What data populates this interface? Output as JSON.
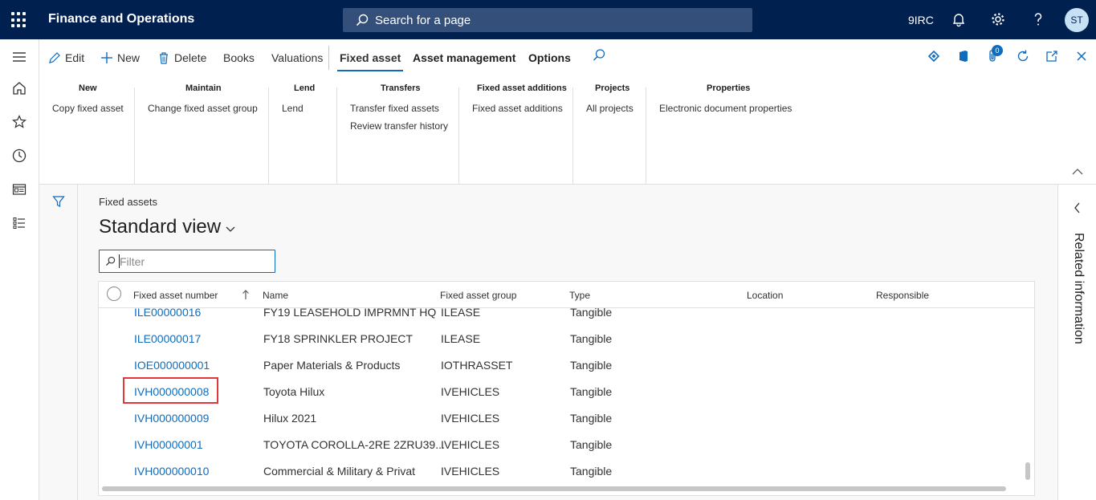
{
  "topbar": {
    "app_title": "Finance and Operations",
    "search_placeholder": "Search for a page",
    "company": "9IRC",
    "avatar_initials": "ST"
  },
  "actionpane": {
    "buttons": {
      "edit": "Edit",
      "new": "New",
      "delete": "Delete",
      "books": "Books",
      "valuations": "Valuations"
    },
    "tabs": {
      "fixed_asset": "Fixed asset",
      "asset_management": "Asset management",
      "options": "Options"
    },
    "attachment_count": "0",
    "groups": [
      {
        "title": "New",
        "items": [
          "Copy fixed asset"
        ]
      },
      {
        "title": "Maintain",
        "items": [
          "Change fixed asset group"
        ]
      },
      {
        "title": "Lend",
        "items": [
          "Lend"
        ]
      },
      {
        "title": "Transfers",
        "items": [
          "Transfer fixed assets",
          "Review transfer history"
        ]
      },
      {
        "title": "Fixed asset additions",
        "items": [
          "Fixed asset additions"
        ]
      },
      {
        "title": "Projects",
        "items": [
          "All projects"
        ]
      },
      {
        "title": "Properties",
        "items": [
          "Electronic document properties"
        ]
      }
    ]
  },
  "content": {
    "breadcrumb": "Fixed assets",
    "view_title": "Standard view",
    "filter_placeholder": "Filter"
  },
  "grid": {
    "columns": [
      "Fixed asset number",
      "Name",
      "Fixed asset group",
      "Type",
      "Location",
      "Responsible"
    ],
    "rows": [
      {
        "number": "ILE00000016",
        "name": "FY19 LEASEHOLD IMPRMNT HQ",
        "group": "ILEASE",
        "type": "Tangible"
      },
      {
        "number": "ILE00000017",
        "name": "FY18 SPRINKLER PROJECT",
        "group": "ILEASE",
        "type": "Tangible"
      },
      {
        "number": "IOE000000001",
        "name": "Paper Materials & Products",
        "group": "IOTHRASSET",
        "type": "Tangible"
      },
      {
        "number": "IVH000000008",
        "name": "Toyota Hilux",
        "group": "IVEHICLES",
        "type": "Tangible"
      },
      {
        "number": "IVH000000009",
        "name": "Hilux 2021",
        "group": "IVEHICLES",
        "type": "Tangible"
      },
      {
        "number": "IVH00000001",
        "name": "TOYOTA COROLLA-2RE  2ZRU39...",
        "group": "IVEHICLES",
        "type": "Tangible"
      },
      {
        "number": "IVH000000010",
        "name": "Commercial & Military & Privat",
        "group": "IVEHICLES",
        "type": "Tangible"
      }
    ]
  },
  "related": {
    "label": "Related information"
  }
}
